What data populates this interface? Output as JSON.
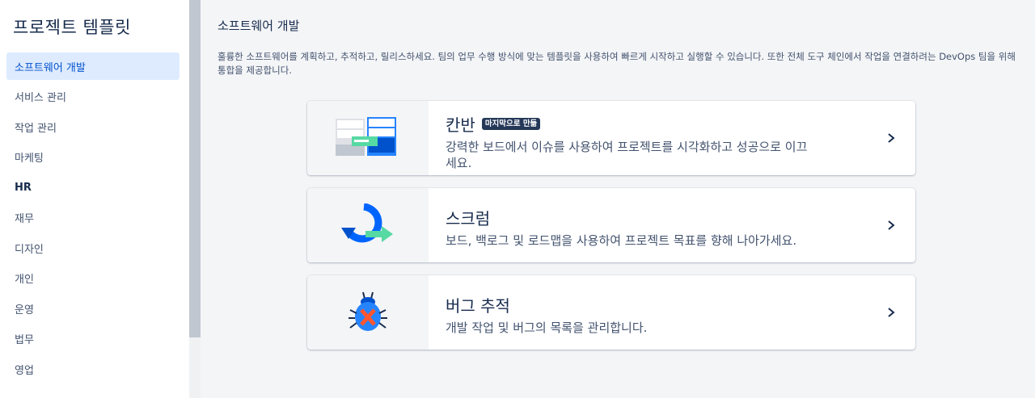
{
  "sidebar": {
    "title": "프로젝트 템플릿",
    "items": [
      {
        "label": "소프트웨어 개발"
      },
      {
        "label": "서비스 관리"
      },
      {
        "label": "작업 관리"
      },
      {
        "label": "마케팅"
      },
      {
        "label": "HR"
      },
      {
        "label": "재무"
      },
      {
        "label": "디자인"
      },
      {
        "label": "개인"
      },
      {
        "label": "운영"
      },
      {
        "label": "법무"
      },
      {
        "label": "영업"
      }
    ],
    "active_index": 0
  },
  "main": {
    "title": "소프트웨어 개발",
    "description": "훌륭한 소프트웨어를 계획하고, 추적하고, 릴리스하세요. 팀의 업무 수행 방식에 맞는 템플릿을 사용하여 빠르게 시작하고 실행할 수 있습니다. 또한 전체 도구 체인에서 작업을 연결하려는 DevOps 팀을 위해 통합을 제공합니다.",
    "cards": [
      {
        "title": "칸반",
        "badge": "마지막으로 만듦",
        "description": "강력한 보드에서 이슈를 사용하여 프로젝트를 시각화하고 성공으로 이끄세요.",
        "icon": "kanban-board-icon"
      },
      {
        "title": "스크럼",
        "description": "보드, 백로그 및 로드맵을 사용하여 프로젝트 목표를 향해 나아가세요.",
        "icon": "scrum-cycle-icon"
      },
      {
        "title": "버그 추적",
        "description": "개발 작업 및 버그의 목록을 관리합니다.",
        "icon": "bug-icon"
      }
    ]
  },
  "colors": {
    "accent": "#0052cc",
    "active_bg": "#deebff",
    "badge_bg": "#253858",
    "text": "#172b4d"
  }
}
